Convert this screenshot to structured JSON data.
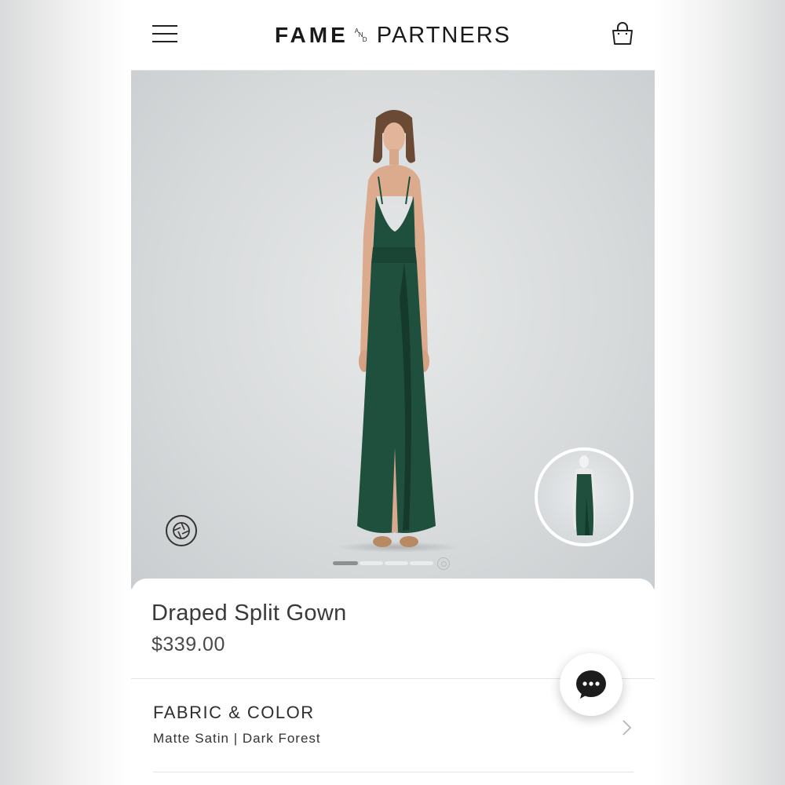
{
  "header": {
    "logo_fame": "FAME",
    "logo_and_a": "A",
    "logo_and_n": "N",
    "logo_and_d": "D",
    "logo_partners": "PARTNERS",
    "menu_icon": "hamburger-menu-icon",
    "cart_icon": "shopping-bag-icon"
  },
  "gallery": {
    "image_count": 4,
    "current_index": 1,
    "camera_icon": "camera-shutter-icon",
    "view_360_icon": "view-360-icon"
  },
  "product": {
    "name": "Draped Split Gown",
    "price": "$339.00"
  },
  "fabric": {
    "heading": "FABRIC & COLOR",
    "value": "Matte Satin | Dark Forest",
    "chevron_icon": "chevron-right-icon"
  },
  "chat": {
    "icon": "chat-bubble-icon"
  },
  "colors": {
    "dress": "#1f4f3d",
    "dress_shadow": "#153a2c",
    "background": "#dadddd"
  }
}
